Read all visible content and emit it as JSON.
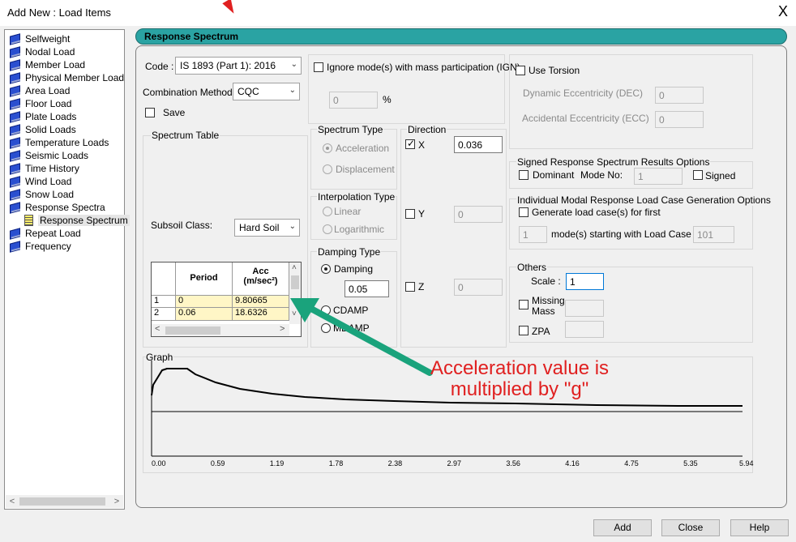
{
  "window": {
    "title": "Add New : Load Items",
    "close_glyph": "X"
  },
  "tree": {
    "items": [
      "Selfweight",
      "Nodal Load",
      "Member Load",
      "Physical Member Load",
      "Area Load",
      "Floor Load",
      "Plate Loads",
      "Solid Loads",
      "Temperature Loads",
      "Seismic Loads",
      "Time History",
      "Wind Load",
      "Snow Load",
      "Response Spectra"
    ],
    "child": "Response Spectrum",
    "items_after": [
      "Repeat Load",
      "Frequency"
    ]
  },
  "header": {
    "title": "Response Spectrum"
  },
  "code": {
    "label": "Code :",
    "value": "IS 1893 (Part 1): 2016"
  },
  "combination": {
    "label": "Combination Method",
    "value": "CQC"
  },
  "save": {
    "label": "Save"
  },
  "ignore": {
    "label": "Ignore mode(s) with mass participation (IGN)",
    "value": "0",
    "unit": "%"
  },
  "torsion": {
    "label": "Use Torsion",
    "dec_label": "Dynamic Eccentricity (DEC)",
    "dec_value": "0",
    "ecc_label": "Accidental Eccentricity (ECC)",
    "ecc_value": "0"
  },
  "spectrum_table": {
    "label": "Spectrum Table",
    "subsoil_label": "Subsoil Class:",
    "subsoil_value": "Hard Soil",
    "col_period": "Period",
    "col_acc": "Acc",
    "col_acc_unit": "(m/sec²)",
    "rows": [
      {
        "n": "1",
        "period": "0",
        "acc": "9.80665"
      },
      {
        "n": "2",
        "period": "0.06",
        "acc": "18.6326"
      }
    ]
  },
  "spectrum_type": {
    "label": "Spectrum Type",
    "opt1": "Acceleration",
    "opt2": "Displacement"
  },
  "interpolation": {
    "label": "Interpolation Type",
    "opt1": "Linear",
    "opt2": "Logarithmic"
  },
  "damping": {
    "label": "Damping Type",
    "opt1": "Damping",
    "value": "0.05",
    "opt2": "CDAMP",
    "opt3": "MDAMP"
  },
  "direction": {
    "label": "Direction",
    "x_label": "X",
    "x_value": "0.036",
    "y_label": "Y",
    "y_value": "0",
    "z_label": "Z",
    "z_value": "0"
  },
  "signed": {
    "label": "Signed Response Spectrum Results Options",
    "dominant": "Dominant",
    "mode_label": "Mode No:",
    "mode_value": "1",
    "signed_label": "Signed"
  },
  "modal": {
    "label": "Individual Modal Response Load Case Generation Options",
    "generate": "Generate load case(s) for first",
    "count": "1",
    "starting": "mode(s) starting with Load Case no.",
    "case_no": "101"
  },
  "others": {
    "label": "Others",
    "scale_label": "Scale :",
    "scale_value": "1",
    "missing_l1": "Missing",
    "missing_l2": "Mass",
    "zpa": "ZPA"
  },
  "graph": {
    "label": "Graph",
    "ticks": [
      "0.00",
      "0.59",
      "1.19",
      "1.78",
      "2.38",
      "2.97",
      "3.56",
      "4.16",
      "4.75",
      "5.35",
      "5.94"
    ]
  },
  "annotation": {
    "line1": "Acceleration value is",
    "line2": "multiplied by \"g\"",
    "color": "#e02020",
    "arrow_color": "#1aa37c"
  },
  "buttons": {
    "add": "Add",
    "close": "Close",
    "help": "Help"
  }
}
